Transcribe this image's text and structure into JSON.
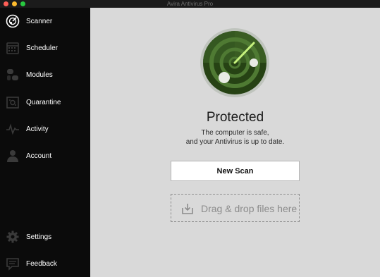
{
  "window": {
    "title": "Avira Antivirus Pro"
  },
  "sidebar": {
    "items": [
      {
        "label": "Scanner",
        "icon": "scanner-icon"
      },
      {
        "label": "Scheduler",
        "icon": "calendar-icon"
      },
      {
        "label": "Modules",
        "icon": "modules-icon"
      },
      {
        "label": "Quarantine",
        "icon": "quarantine-icon"
      },
      {
        "label": "Activity",
        "icon": "activity-icon"
      },
      {
        "label": "Account",
        "icon": "account-icon"
      }
    ],
    "bottom_items": [
      {
        "label": "Settings",
        "icon": "gear-icon"
      },
      {
        "label": "Feedback",
        "icon": "feedback-icon"
      }
    ]
  },
  "main": {
    "status_title": "Protected",
    "status_line1": "The computer is safe,",
    "status_line2": "and your Antivirus is up to date.",
    "new_scan_label": "New Scan",
    "drop_label": "Drag & drop files here"
  },
  "colors": {
    "radar_green": "#4f7a33",
    "radar_dark": "#264214",
    "sidebar_bg": "#0b0b0b",
    "content_bg": "#d9d9d9"
  }
}
